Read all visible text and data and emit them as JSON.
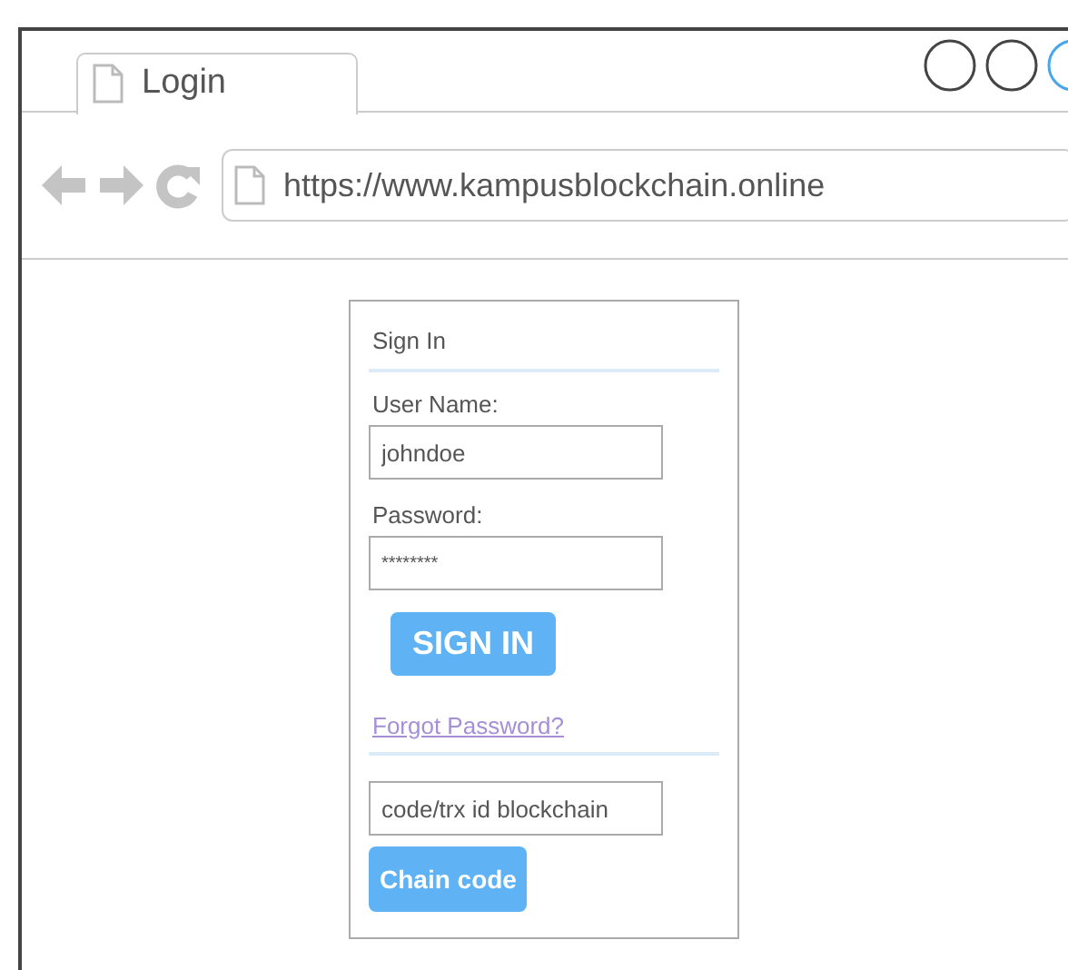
{
  "tab": {
    "title": "Login",
    "selected": true
  },
  "address_bar": {
    "url": "https://www.kampusblockchain.online"
  },
  "form": {
    "title": "Sign In",
    "fields": [
      {
        "label": "User Name:",
        "value": "johndoe"
      },
      {
        "label": "Password:",
        "value": "********"
      }
    ],
    "sign_in_button": "SIGN IN",
    "forgot_link": "Forgot Password?",
    "code_field": {
      "placeholder": "code/trx id blockchain"
    },
    "chain_button": "Chain code"
  }
}
